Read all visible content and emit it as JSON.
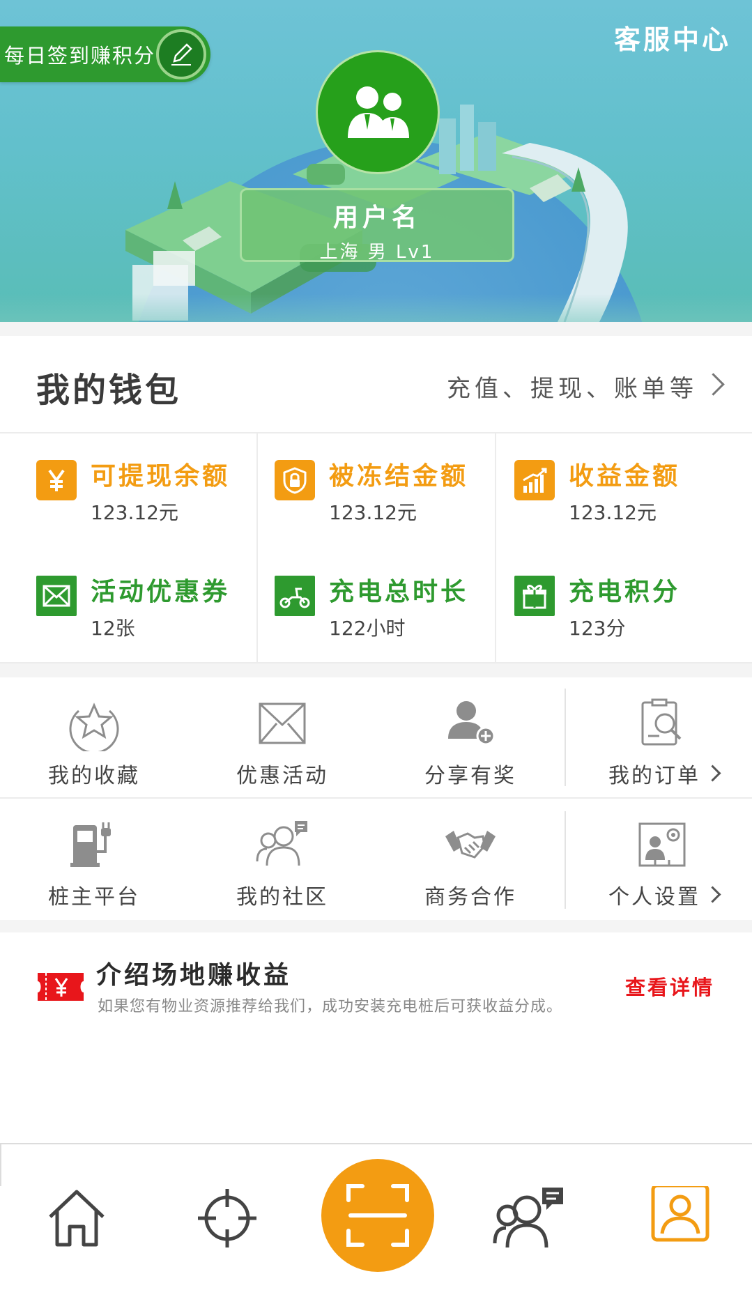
{
  "header": {
    "checkin_label": "每日签到赚积分",
    "service_label": "客服中心",
    "user": {
      "name": "用户名",
      "meta": "上海 男 Lv1"
    }
  },
  "wallet": {
    "title": "我的钱包",
    "link": "充值、提现、账单等",
    "cells": [
      {
        "title": "可提现余额",
        "value": "123.12元",
        "icon": "yen-icon",
        "color": "#f39c12"
      },
      {
        "title": "被冻结金额",
        "value": "123.12元",
        "icon": "lock-shield-icon",
        "color": "#f39c12"
      },
      {
        "title": "收益金额",
        "value": "123.12元",
        "icon": "growth-chart-icon",
        "color": "#f39c12"
      },
      {
        "title": "活动优惠券",
        "value": "12张",
        "icon": "coupon-envelope-icon",
        "color": "#2e9a2f"
      },
      {
        "title": "充电总时长",
        "value": "122小时",
        "icon": "scooter-icon",
        "color": "#2e9a2f"
      },
      {
        "title": "充电积分",
        "value": "123分",
        "icon": "gift-icon",
        "color": "#2e9a2f"
      }
    ]
  },
  "menu": {
    "items": [
      {
        "label": "我的收藏",
        "icon": "star-icon"
      },
      {
        "label": "优惠活动",
        "icon": "envelope-icon"
      },
      {
        "label": "分享有奖",
        "icon": "add-user-icon"
      },
      {
        "label": "我的订单",
        "icon": "order-search-icon"
      },
      {
        "label": "桩主平台",
        "icon": "charging-station-icon"
      },
      {
        "label": "我的社区",
        "icon": "community-icon"
      },
      {
        "label": "商务合作",
        "icon": "handshake-icon"
      },
      {
        "label": "个人设置",
        "icon": "profile-settings-icon"
      }
    ]
  },
  "promo": {
    "title": "介绍场地赚收益",
    "desc": "如果您有物业资源推荐给我们，成功安装充电桩后可获收益分成。",
    "link": "查看详情",
    "icon": "ticket-yen-icon"
  },
  "nav": {
    "items": [
      "home-icon",
      "locate-icon",
      "scan-icon",
      "community-icon",
      "profile-icon"
    ],
    "active": "profile-icon"
  }
}
